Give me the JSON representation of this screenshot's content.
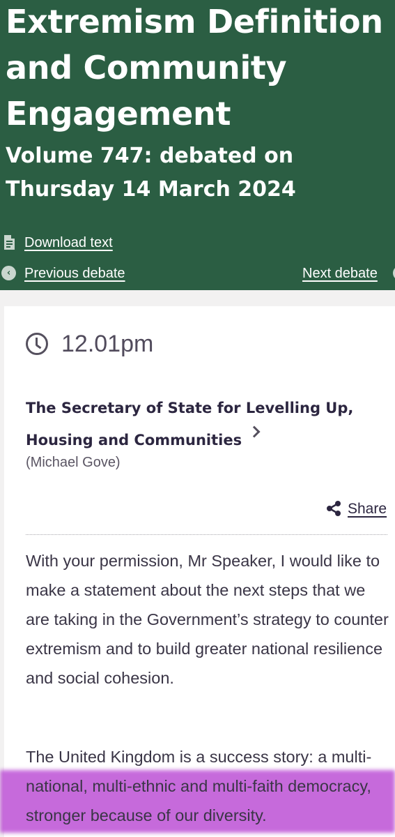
{
  "header": {
    "title": "Extremism Definition and Community Engagement",
    "subtitle": "Volume 747: debated on Thursday 14 March 2024",
    "download_text": "Download text",
    "previous_debate": "Previous debate",
    "next_debate": "Next debate"
  },
  "icons": {
    "download": "document-icon",
    "previous": "chevron-left-circle-icon",
    "next": "chevron-right-circle-icon",
    "time": "clock-icon",
    "speaker": "chevron-right-icon",
    "share": "share-icon"
  },
  "contribution": {
    "time": "12.01pm",
    "speaker": "The Secretary of State for Levelling Up, Housing and Communities",
    "member": "(Michael Gove)",
    "share_label": "Share",
    "paragraphs": [
      "With your permission, Mr Speaker, I would like to make a statement about the next steps that we are taking in the Government’s strategy to counter extremism and to build greater national resilience and social cohesion.",
      "The United Kingdom is a success story: a multi-national, multi-ethnic and multi-faith democracy, stronger because of our diversity."
    ]
  },
  "colors": {
    "header_green": "#2b5e43",
    "highlight_purple": "#b030cd",
    "text_dark": "#2c2640"
  }
}
